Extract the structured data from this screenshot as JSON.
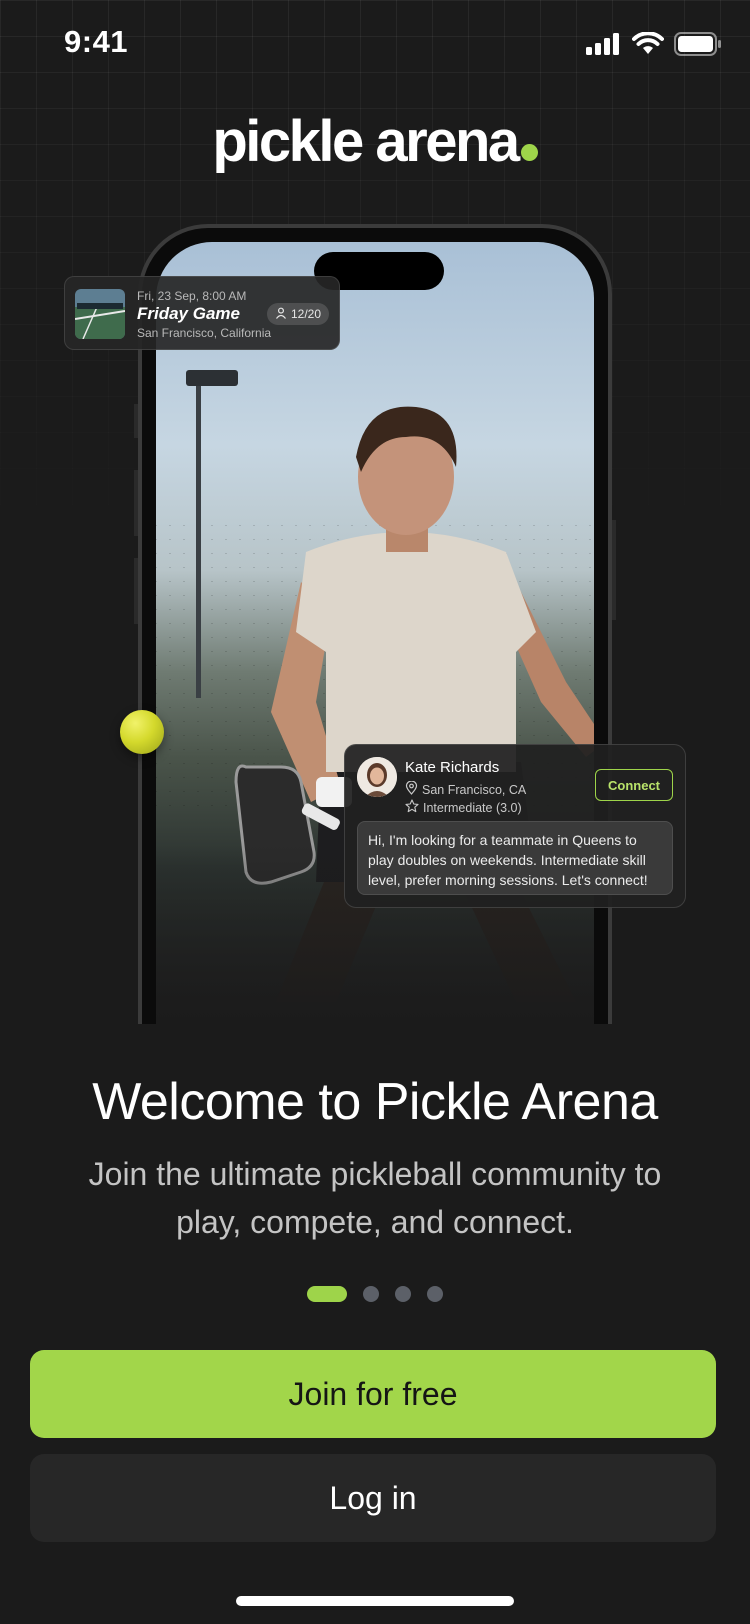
{
  "status_bar": {
    "time": "9:41",
    "icons": [
      "cellular-signal-icon",
      "wifi-icon",
      "battery-icon"
    ]
  },
  "logo": {
    "text": "pickle arena",
    "dot_color": "#9ed44a"
  },
  "game_card": {
    "date": "Fri, 23 Sep, 8:00 AM",
    "title": "Friday Game",
    "location": "San Francisco, California",
    "players": "12/20",
    "icon": "person-icon"
  },
  "profile_card": {
    "name": "Kate Richards",
    "location": "San Francisco, CA",
    "level": "Intermediate (3.0)",
    "connect_label": "Connect",
    "message": "Hi, I'm looking for a teammate in Queens to play doubles on weekends. Intermediate skill level, prefer morning sessions. Let's connect!",
    "icons": [
      "location-pin-icon",
      "star-icon"
    ]
  },
  "welcome": {
    "title": "Welcome to Pickle Arena",
    "subtitle": "Join the ultimate pickleball community to play, compete, and connect."
  },
  "pager": {
    "total": 4,
    "active_index": 0
  },
  "buttons": {
    "join_label": "Join for free",
    "login_label": "Log in"
  },
  "colors": {
    "accent": "#a2d64a",
    "background": "#1b1b1b",
    "secondary_button": "#272727"
  }
}
